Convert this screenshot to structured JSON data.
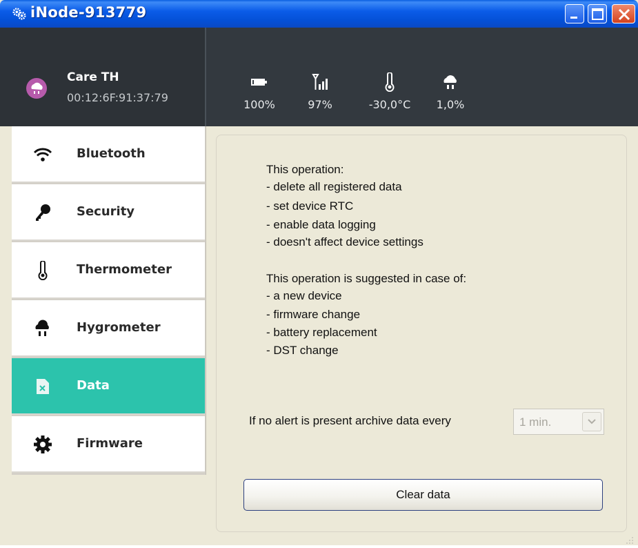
{
  "window": {
    "title": "iNode-913779"
  },
  "device": {
    "name": "Care TH",
    "mac": "00:12:6F:91:37:79"
  },
  "status": [
    {
      "icon": "battery-icon",
      "value": "100%"
    },
    {
      "icon": "signal-icon",
      "value": "97%"
    },
    {
      "icon": "thermometer-icon",
      "value": "-30,0°C"
    },
    {
      "icon": "humidity-icon",
      "value": "1,0%"
    }
  ],
  "nav": {
    "items": [
      {
        "label": "Bluetooth",
        "icon": "wifi-icon"
      },
      {
        "label": "Security",
        "icon": "key-icon"
      },
      {
        "label": "Thermometer",
        "icon": "thermometer-icon"
      },
      {
        "label": "Hygrometer",
        "icon": "cloud-rain-icon"
      },
      {
        "label": "Data",
        "icon": "file-icon",
        "active": true
      },
      {
        "label": "Firmware",
        "icon": "gear-icon"
      }
    ]
  },
  "info": {
    "lines": [
      "This operation:",
      "- delete all registered data",
      "- set device RTC",
      "- enable data logging",
      "- doesn't affect device settings",
      "",
      "This operation is suggested in case of:",
      "- a new device",
      "- firmware change",
      "- battery replacement",
      "- DST change"
    ]
  },
  "archive": {
    "label": "If no alert is present archive data every",
    "selected": "1 min."
  },
  "actions": {
    "clear_label": "Clear data"
  },
  "colors": {
    "accent": "#2cc3ac",
    "header": "#33393f",
    "titlebar": "#0b5ce8"
  }
}
